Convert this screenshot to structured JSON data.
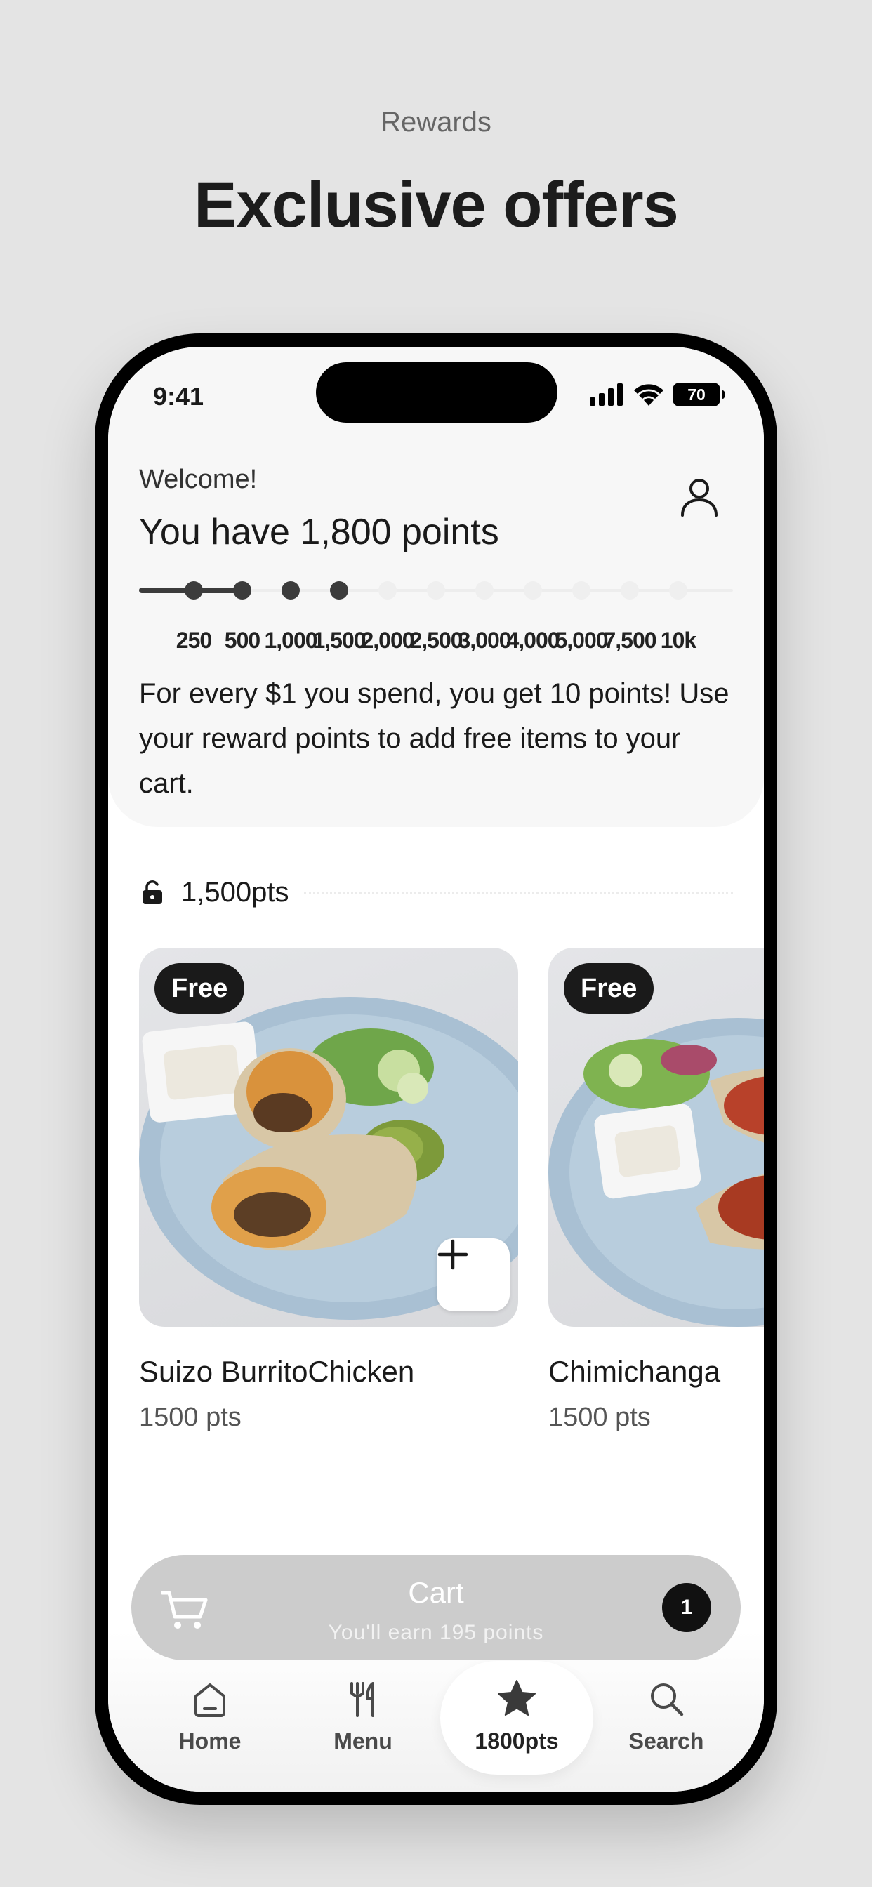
{
  "page": {
    "kicker": "Rewards",
    "headline": "Exclusive offers"
  },
  "status_bar": {
    "time": "9:41",
    "battery": "70",
    "icons": [
      "signal-icon",
      "wifi-icon",
      "battery-icon"
    ]
  },
  "header": {
    "welcome": "Welcome!",
    "points_title": "You have 1,800 points",
    "profile_icon": "user-icon",
    "progress": {
      "current_points": 1800,
      "milestones": [
        "250",
        "500",
        "1,000",
        "1,500",
        "2,000",
        "2,500",
        "3,000",
        "4,000",
        "5,000",
        "7,500",
        "10k"
      ],
      "unlocked_count": 4
    },
    "intro": "For every $1 you spend, you get 10 points! Use your reward points to add free items to your cart."
  },
  "section": {
    "icon": "unlock-icon",
    "label": "1,500pts"
  },
  "offers": [
    {
      "badge": "Free",
      "name": "Suizo BurritoChicken",
      "points": "1500 pts",
      "add_icon": "plus-icon"
    },
    {
      "badge": "Free",
      "name": "Chimichanga",
      "points": "1500 pts"
    }
  ],
  "cart": {
    "title": "Cart",
    "subtitle": "You'll earn 195 points",
    "count": "1",
    "icon": "cart-icon"
  },
  "tabs": [
    {
      "label": "Home",
      "icon": "home-icon"
    },
    {
      "label": "Menu",
      "icon": "utensils-icon"
    },
    {
      "label": "1800pts",
      "icon": "star-icon",
      "active": true
    },
    {
      "label": "Search",
      "icon": "search-icon"
    }
  ],
  "colors": {
    "background": "#e4e4e4",
    "accent_dark": "#1a1a1a",
    "cart_bar": "#cccccc",
    "progress_fill": "#3c3c3c"
  }
}
